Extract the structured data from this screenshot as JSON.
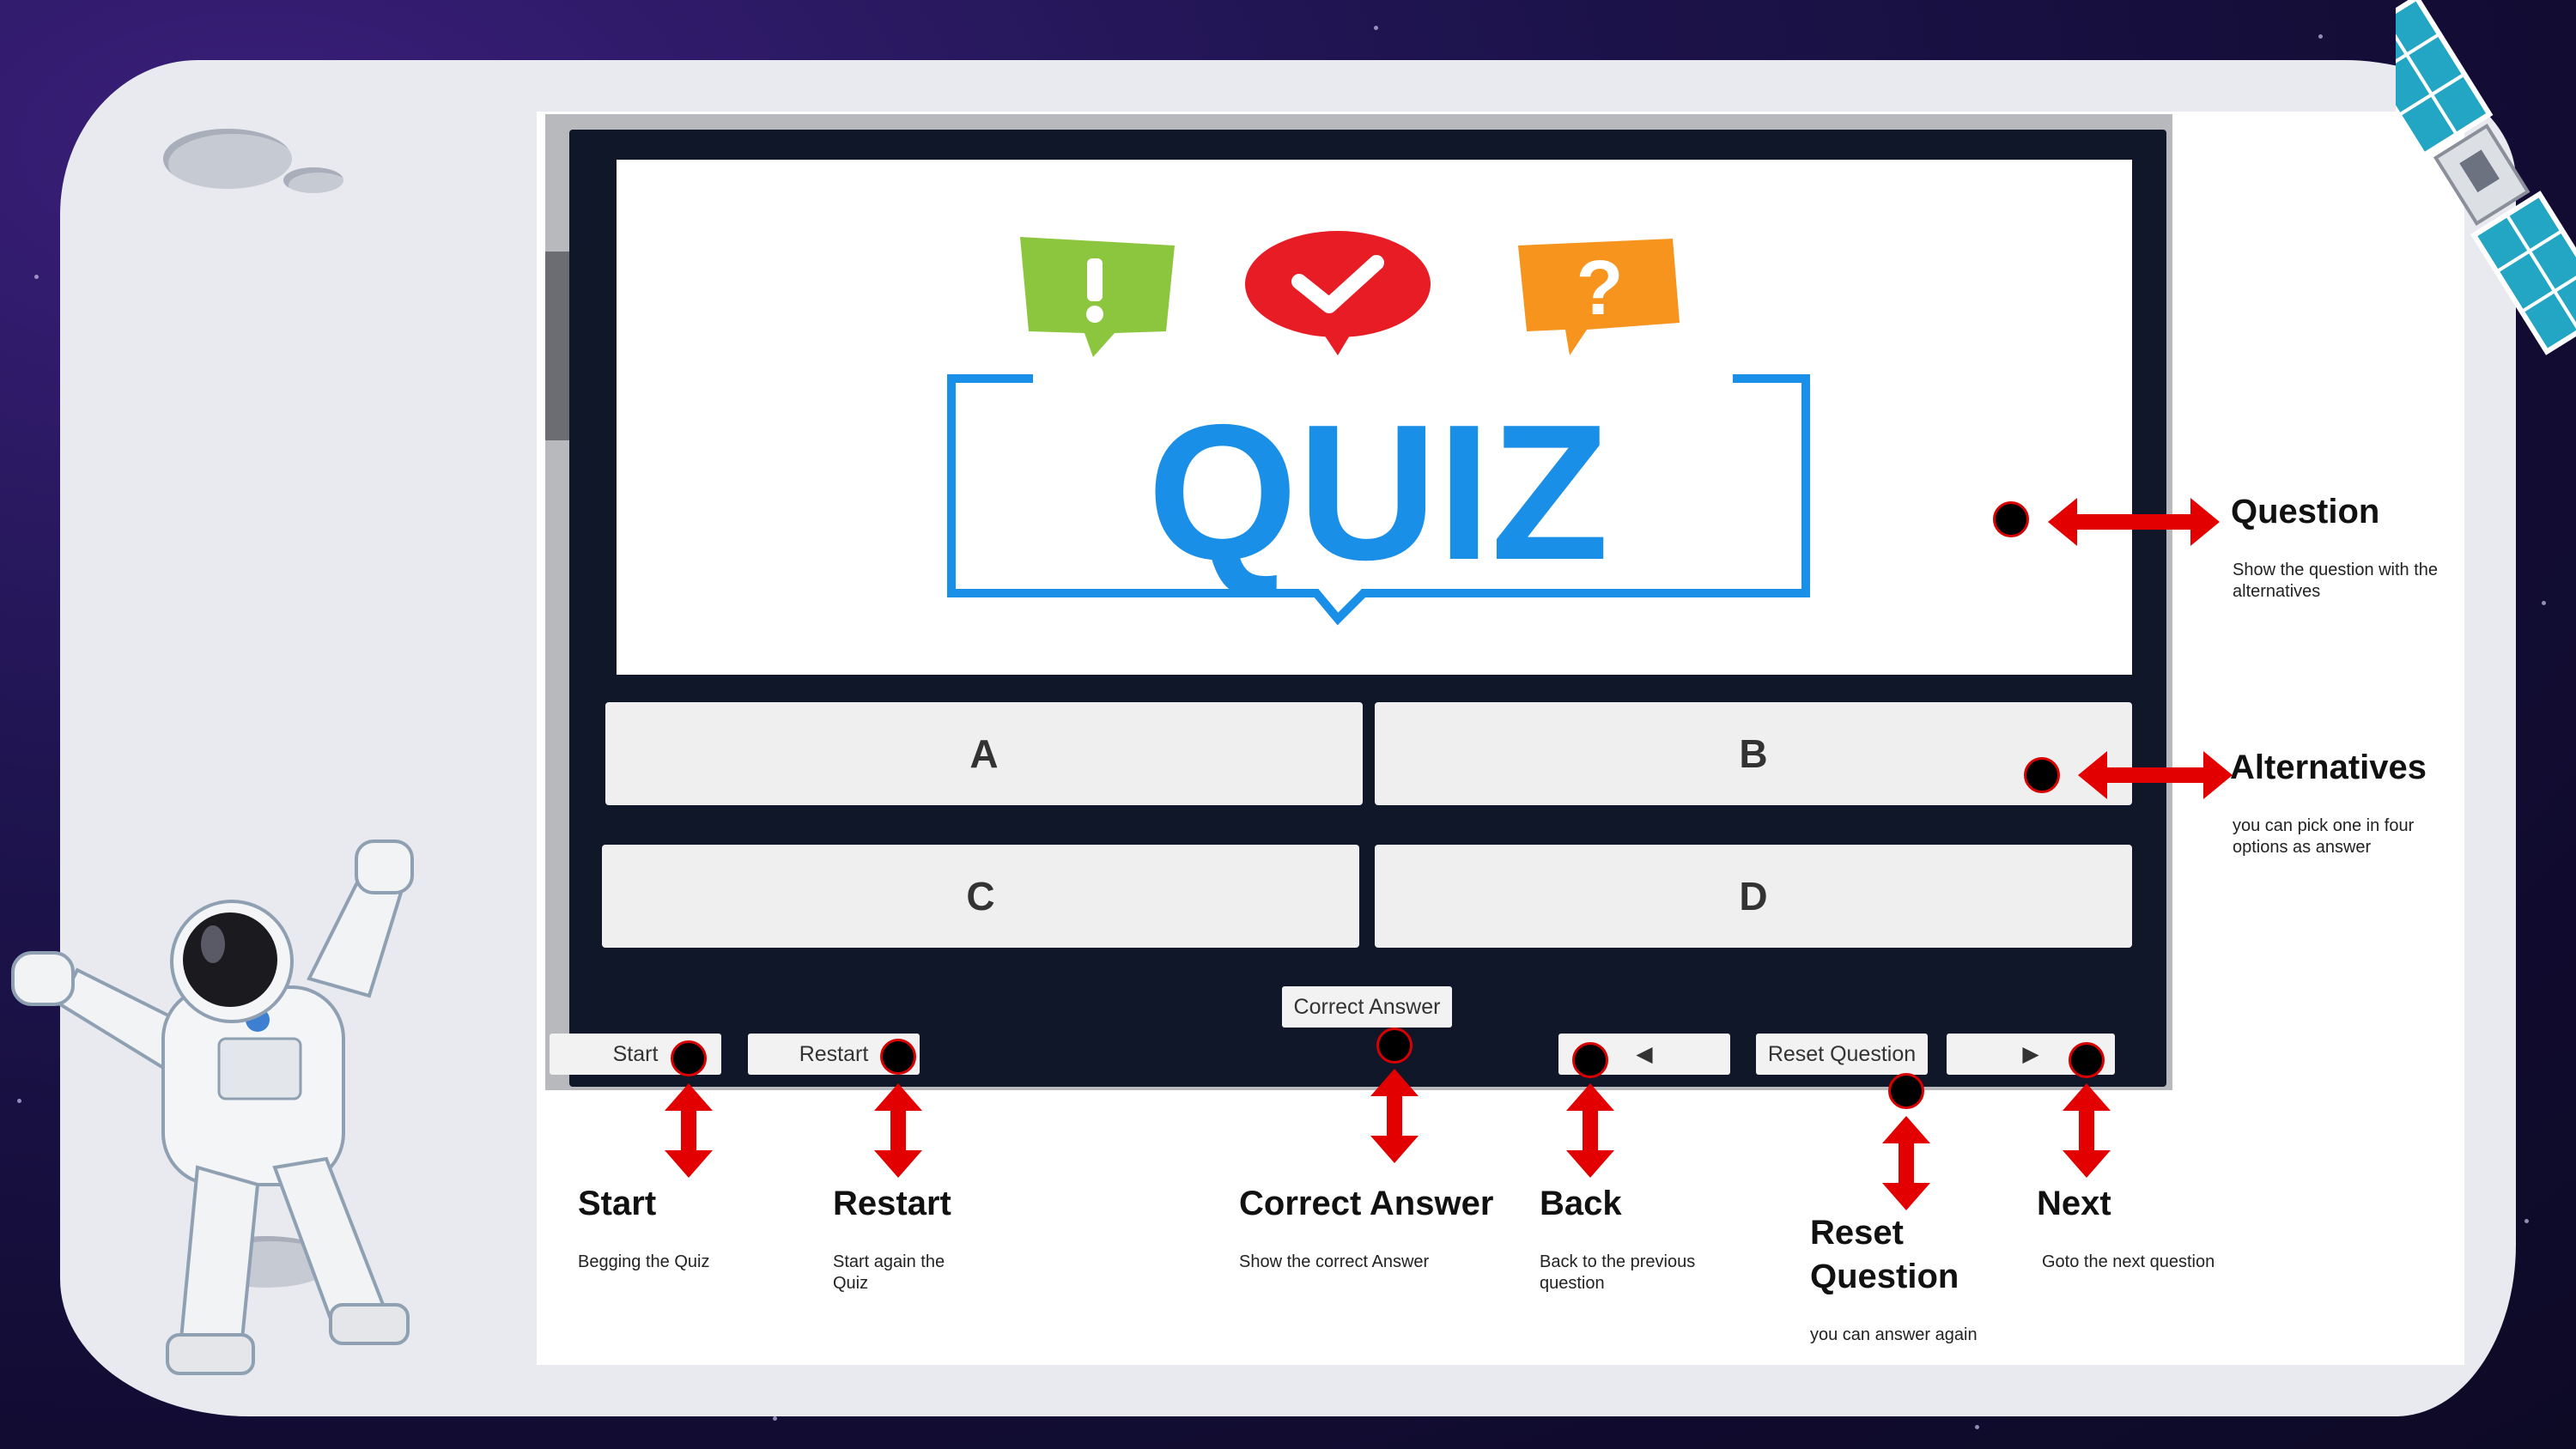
{
  "game": {
    "question_logo_text": "QUIZ",
    "alternatives": [
      {
        "label": "A"
      },
      {
        "label": "B"
      },
      {
        "label": "C"
      },
      {
        "label": "D"
      }
    ],
    "buttons": {
      "start": "Start",
      "restart": "Restart",
      "correct_answer": "Correct Answer",
      "back_glyph": "◀",
      "reset_question": "Reset Question",
      "next_glyph": "▶"
    }
  },
  "annotations": {
    "question": {
      "title": "Question",
      "desc": "Show the question with the alternatives"
    },
    "alternatives": {
      "title": "Alternatives",
      "desc": "you can pick one in four options as answer"
    },
    "start": {
      "title": "Start",
      "desc": "Begging the Quiz"
    },
    "restart": {
      "title": "Restart",
      "desc": "Start again the Quiz"
    },
    "correct_answer": {
      "title": "Correct Answer",
      "desc": "Show the correct Answer"
    },
    "back": {
      "title": "Back",
      "desc": "Back to the previous question"
    },
    "reset_question": {
      "title_line1": "Reset",
      "title_line2": "Question",
      "desc": "you can answer again"
    },
    "next": {
      "title": "Next",
      "desc": "Goto the next question"
    }
  },
  "colors": {
    "arrow_red": "#e30000",
    "quiz_blue": "#1a8fe8",
    "bubble_green": "#8cc63f",
    "bubble_red": "#e81c24",
    "bubble_orange": "#f7941d"
  }
}
